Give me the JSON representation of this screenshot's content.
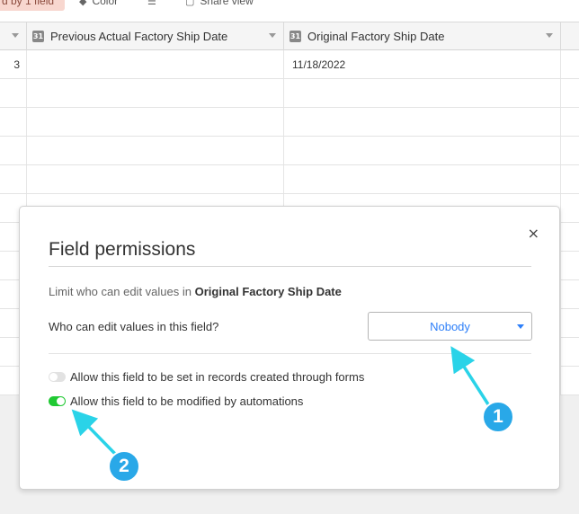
{
  "toolbar": {
    "sort_label": "d by 1 field",
    "color_label": "Color",
    "share_label": "Share view",
    "row_height_icon": "row-height-icon",
    "color_icon": "paint-bucket-icon",
    "share_icon": "share-icon"
  },
  "grid": {
    "columns": [
      {
        "label": "",
        "icon": "chevron-down-icon"
      },
      {
        "label": "Previous Actual Factory Ship Date",
        "icon": "calendar-icon",
        "icon_text": "31"
      },
      {
        "label": "Original Factory Ship Date",
        "icon": "calendar-icon",
        "icon_text": "31"
      }
    ],
    "rows": [
      {
        "num": "3",
        "prev": "",
        "orig": "11/18/2022"
      }
    ]
  },
  "modal": {
    "title": "Field permissions",
    "desc_prefix": "Limit who can edit values in",
    "field_name": "Original Factory Ship Date",
    "question": "Who can edit values in this field?",
    "select_value": "Nobody",
    "forms_toggle_label": "Allow this field to be set in records created through forms",
    "forms_toggle_on": false,
    "automations_toggle_label": "Allow this field to be modified by automations",
    "automations_toggle_on": true,
    "close_glyph": "×"
  },
  "annotations": {
    "badge_1": "1",
    "badge_2": "2",
    "color": "#29a8e8",
    "arrow_color": "#2ad3e8"
  },
  "colors": {
    "accent_blue": "#2d7ff9",
    "toggle_on": "#20c933",
    "sort_highlight": "#f8d7cf"
  }
}
